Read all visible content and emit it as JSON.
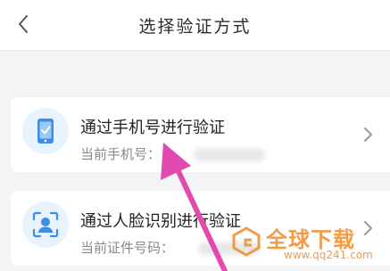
{
  "header": {
    "title": "选择验证方式"
  },
  "options": [
    {
      "title": "通过手机号进行验证",
      "sub_label": "当前手机号：",
      "icon": "phone-check-icon"
    },
    {
      "title": "通过人脸识别进行验证",
      "sub_label": "当前证件号码：",
      "icon": "face-scan-icon"
    }
  ],
  "watermark": {
    "text": "全球下载",
    "url": "www.qq241.com"
  },
  "colors": {
    "accent": "#3a8ee6",
    "icon_bg": "#e9f3fd",
    "arrow": "#e14bb0",
    "watermark": "#f08a2a"
  }
}
